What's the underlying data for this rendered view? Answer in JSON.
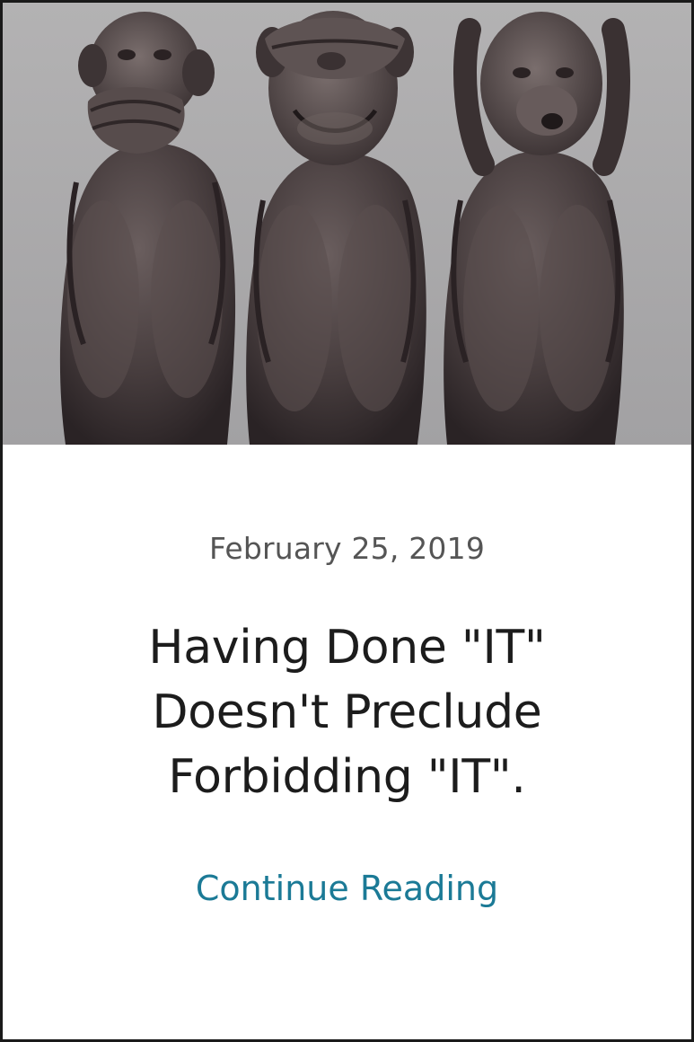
{
  "post": {
    "date": "February 25, 2019",
    "title": "Having Done \"IT\" Doesn't Preclude Forbidding \"IT\".",
    "continue_label": "Continue Reading",
    "image_subject": "three-monkeys-statue"
  },
  "colors": {
    "link": "#1b7a96",
    "title": "#1c1c1c",
    "date": "#555555",
    "image_background": "#a9a8a9"
  }
}
